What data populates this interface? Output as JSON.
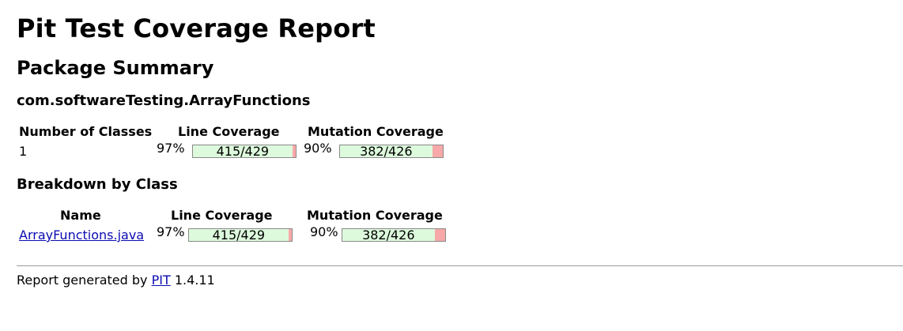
{
  "report_title": "Pit Test Coverage Report",
  "package_summary_heading": "Package Summary",
  "package_name": "com.softwareTesting.ArrayFunctions",
  "package_table": {
    "headers": {
      "classes": "Number of Classes",
      "line": "Line Coverage",
      "mutation": "Mutation Coverage"
    },
    "row": {
      "classes": "1",
      "line_pct": "97%",
      "line_ratio": "415/429",
      "line_fraction": 0.967,
      "mutation_pct": "90%",
      "mutation_ratio": "382/426",
      "mutation_fraction": 0.897
    }
  },
  "breakdown_heading": "Breakdown by Class",
  "class_table": {
    "headers": {
      "name": "Name",
      "line": "Line Coverage",
      "mutation": "Mutation Coverage"
    },
    "rows": [
      {
        "name": "ArrayFunctions.java",
        "line_pct": "97%",
        "line_ratio": "415/429",
        "line_fraction": 0.967,
        "mutation_pct": "90%",
        "mutation_ratio": "382/426",
        "mutation_fraction": 0.897
      }
    ]
  },
  "footer": {
    "prefix": "Report generated by",
    "link": "PIT",
    "version": "1.4.11"
  },
  "colors": {
    "covered": "#ddfadd",
    "uncovered": "#f8a8a8",
    "link": "#0b0bb3"
  }
}
